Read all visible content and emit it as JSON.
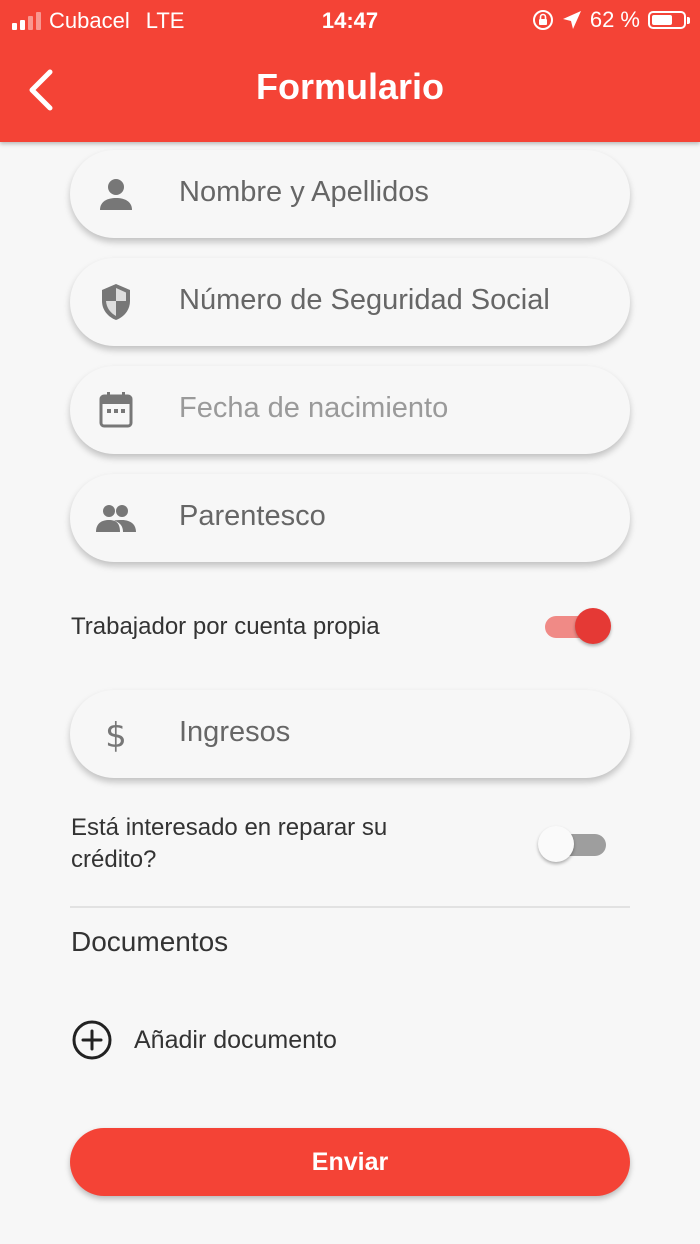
{
  "status_bar": {
    "carrier": "Cubacel",
    "network": "LTE",
    "time": "14:47",
    "battery_text": "62 %",
    "battery_level": 0.62
  },
  "app_bar": {
    "title": "Formulario",
    "back_icon": "chevron-left-icon",
    "color": "#f44336"
  },
  "form": {
    "fields": [
      {
        "icon": "person-icon",
        "text": "Nombre y Apellidos"
      },
      {
        "icon": "shield-icon",
        "text": "Número de Seguridad Social"
      },
      {
        "icon": "calendar-icon",
        "text": "Fecha de nacimiento"
      },
      {
        "icon": "people-icon",
        "text": "Parentesco"
      }
    ],
    "self_employed": {
      "label": "Trabajador por cuenta propia",
      "on": true
    },
    "income": {
      "icon": "dollar-icon",
      "text": "Ingresos"
    },
    "credit_repair": {
      "label_line1": "Está interesado en reparar su",
      "label_line2": "crédito?",
      "on": false
    }
  },
  "documents": {
    "heading": "Documentos",
    "add_label": "Añadir documento",
    "add_icon": "plus-circle-icon"
  },
  "submit": {
    "label": "Enviar"
  },
  "colors": {
    "accent": "#f44336",
    "switch_on": "#e53935",
    "switch_off_track": "#9e9e9e"
  }
}
